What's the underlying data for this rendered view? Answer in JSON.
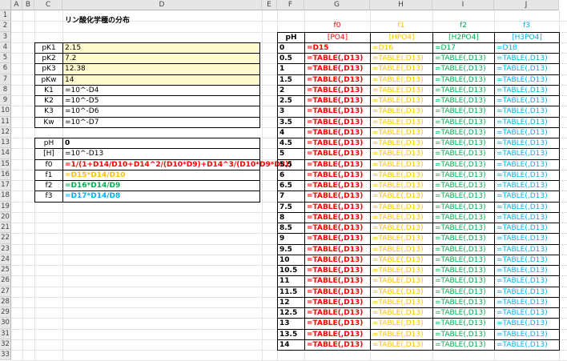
{
  "sheet": {
    "columns": [
      "A",
      "B",
      "C",
      "D",
      "E",
      "F",
      "G",
      "H",
      "I",
      "J"
    ],
    "rows": [
      "1",
      "2",
      "3",
      "4",
      "5",
      "6",
      "7",
      "8",
      "9",
      "10",
      "11",
      "12",
      "13",
      "14",
      "15",
      "16",
      "17",
      "18",
      "19",
      "20",
      "21",
      "22",
      "23",
      "24",
      "25",
      "26",
      "27",
      "28",
      "29",
      "30",
      "31",
      "32",
      "33"
    ],
    "title": "リン酸化学種の分布"
  },
  "params": {
    "items": [
      {
        "label": "pK1",
        "value": "2.15"
      },
      {
        "label": "pK2",
        "value": "7.2"
      },
      {
        "label": "pK3",
        "value": "12.38"
      },
      {
        "label": "pKw",
        "value": "14"
      },
      {
        "label": "K1",
        "value": "=10^-D4"
      },
      {
        "label": "K2",
        "value": "=10^-D5"
      },
      {
        "label": "K3",
        "value": "=10^-D6"
      },
      {
        "label": "Kw",
        "value": "=10^-D7"
      }
    ]
  },
  "calc": {
    "items": [
      {
        "label": "pH",
        "value": "0"
      },
      {
        "label": "[H]",
        "value": "=10^-D13"
      },
      {
        "label": "f0",
        "value": "=1/(1+D14/D10+D14^2/(D10*D9)+D14^3/(D10*D9*D8))"
      },
      {
        "label": "f1",
        "value": "=D15*D14/D10"
      },
      {
        "label": "f2",
        "value": "=D16*D14/D9"
      },
      {
        "label": "f3",
        "value": "=D17*D14/D8"
      }
    ]
  },
  "table": {
    "fheaders": [
      "f0",
      "f1",
      "f2",
      "f3"
    ],
    "ph_header": "pH",
    "species": [
      "[PO4]",
      "[HPO4]",
      "[H2PO4]",
      "[H3PO4]"
    ],
    "first_row": [
      "=D15",
      "=D16",
      "=D17",
      "=D18"
    ],
    "table_formula": "=TABLE(,D13)",
    "ph_values": [
      "0",
      "0.5",
      "1",
      "1.5",
      "2",
      "2.5",
      "3",
      "3.5",
      "4",
      "4.5",
      "5",
      "5.5",
      "6",
      "6.5",
      "7",
      "7.5",
      "8",
      "8.5",
      "9",
      "9.5",
      "10",
      "10.5",
      "11",
      "11.5",
      "12",
      "12.5",
      "13",
      "13.5",
      "14"
    ]
  },
  "colors": {
    "f0": "#ff0000",
    "f1": "#ffc000",
    "f2": "#00b050",
    "f3": "#00b0f0",
    "param_fill": "#fffacd",
    "header_fill": "#e6e6e6"
  }
}
